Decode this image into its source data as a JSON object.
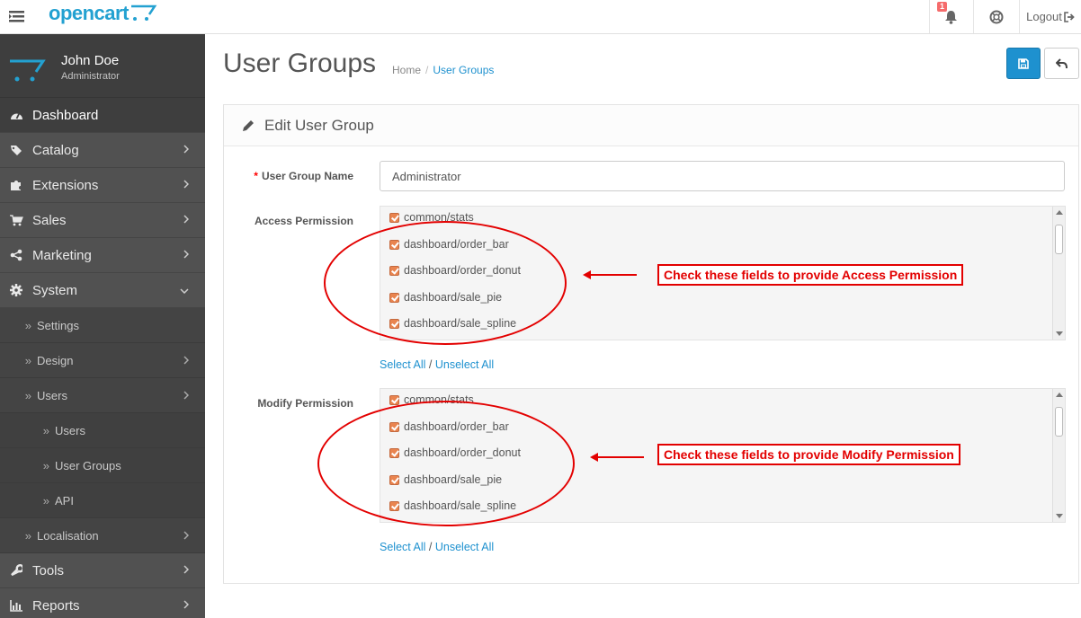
{
  "header": {
    "logo_text": "opencart",
    "notification_count": "1",
    "logout_label": "Logout"
  },
  "sidebar": {
    "user_name": "John Doe",
    "user_role": "Administrator",
    "items": [
      {
        "label": "Dashboard",
        "icon": "dashboard-icon"
      },
      {
        "label": "Catalog",
        "icon": "tag-icon"
      },
      {
        "label": "Extensions",
        "icon": "puzzle-icon"
      },
      {
        "label": "Sales",
        "icon": "cart-icon"
      },
      {
        "label": "Marketing",
        "icon": "share-icon"
      },
      {
        "label": "System",
        "icon": "cog-icon"
      }
    ],
    "system_sub": [
      "Settings",
      "Design",
      "Users"
    ],
    "users_sub": [
      "Users",
      "User Groups",
      "API"
    ],
    "localisation": "Localisation",
    "tools": "Tools",
    "reports": "Reports"
  },
  "page": {
    "title": "User Groups",
    "breadcrumb_home": "Home",
    "breadcrumb_current": "User Groups"
  },
  "panel": {
    "heading": "Edit User Group",
    "group_name_label": "User Group Name",
    "group_name_value": "Administrator",
    "access_label": "Access Permission",
    "modify_label": "Modify Permission",
    "permissions": [
      "common/stats",
      "dashboard/order_bar",
      "dashboard/order_donut",
      "dashboard/sale_pie",
      "dashboard/sale_spline"
    ],
    "select_all": "Select All",
    "unselect_all": "Unselect All",
    "slash": "/"
  },
  "annotations": {
    "access_callout": "Check these fields to provide Access Permission",
    "modify_callout": "Check these fields to provide Modify Permission",
    "color": "#e30000"
  }
}
